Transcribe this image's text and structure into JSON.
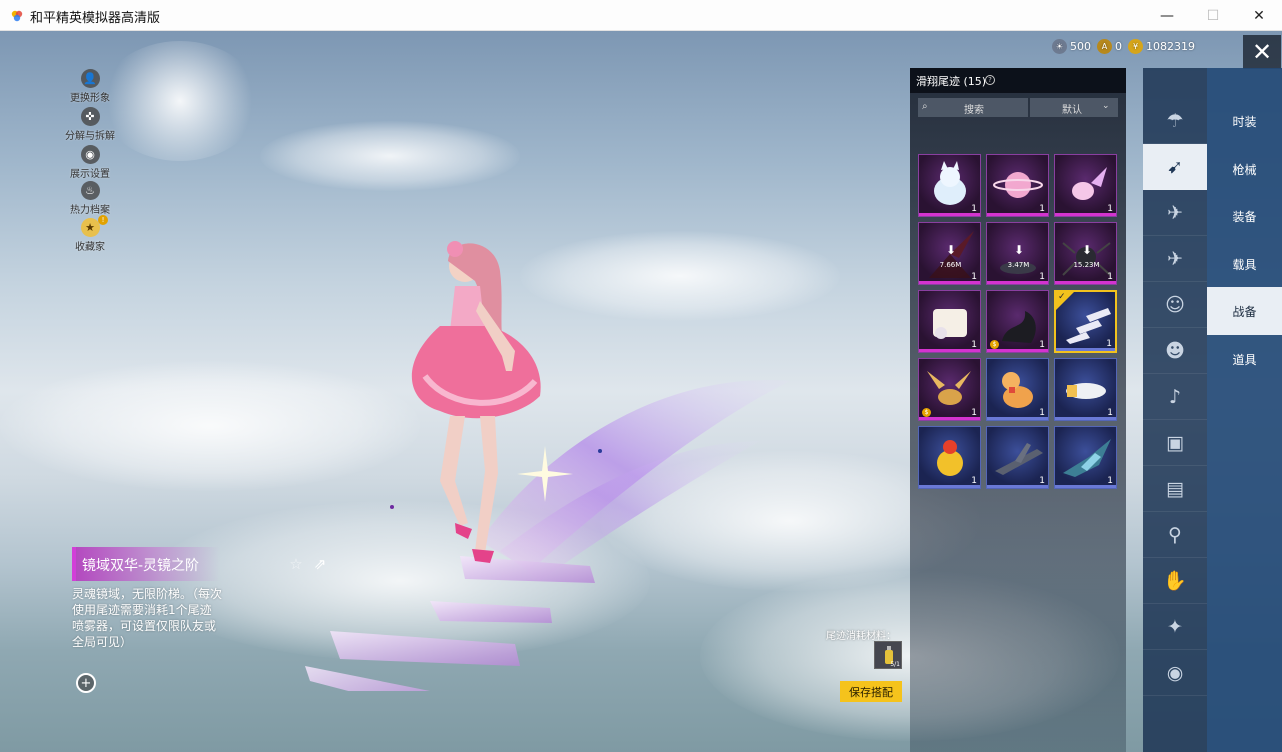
{
  "window": {
    "title": "和平精英模拟器高清版",
    "minimize": "—",
    "maximize": "☐",
    "close": "✕"
  },
  "tools": [
    {
      "label": "更换形象",
      "icon": "person-icon"
    },
    {
      "label": "分解与拆解",
      "icon": "decompose-icon"
    },
    {
      "label": "展示设置",
      "icon": "eye-icon"
    },
    {
      "label": "热力档案",
      "icon": "flame-icon"
    },
    {
      "label": "收藏家",
      "icon": "collector-icon"
    }
  ],
  "item": {
    "name": "镜域双华-灵镜之阶",
    "description": "灵魂镜域，无限阶梯。（每次使用尾迹需要消耗1个尾迹喷雾器，可设置仅限队友或全局可见）",
    "star": "☆",
    "share": "⇗",
    "zoom": "+"
  },
  "currency": [
    {
      "value": "500",
      "icon": "sun-coin-icon",
      "color": "#6d7a90"
    },
    {
      "value": "0",
      "icon": "ag-coin-icon",
      "color": "#b7891d"
    },
    {
      "value": "1082319",
      "icon": "gold-coin-icon",
      "color": "#d6a51a"
    }
  ],
  "close_label": "✕",
  "panel": {
    "title": "滑翔尾迹 (15)",
    "help": "?",
    "search_placeholder": "搜索",
    "search_icon": "⌕",
    "sort_label": "默认",
    "sort_chevron": "⌄"
  },
  "grid_items": [
    {
      "name": "cat-trail",
      "tier": "purple",
      "count": "1"
    },
    {
      "name": "planet-trail",
      "tier": "purple",
      "count": "1"
    },
    {
      "name": "crystal-trail",
      "tier": "purple",
      "count": "1"
    },
    {
      "name": "dark-blade-trail",
      "tier": "purple",
      "count": "1",
      "download": "7.66M"
    },
    {
      "name": "shark-trail",
      "tier": "purple",
      "count": "1",
      "download": "3.47M"
    },
    {
      "name": "spider-trail",
      "tier": "purple",
      "count": "1",
      "download": "15.23M"
    },
    {
      "name": "bunny-box-trail",
      "tier": "purple",
      "count": "1"
    },
    {
      "name": "dragon-trail",
      "tier": "purple",
      "count": "1",
      "locked": true
    },
    {
      "name": "mirror-steps-trail",
      "tier": "blue",
      "count": "1",
      "selected": true
    },
    {
      "name": "pegasus-trail",
      "tier": "purple",
      "count": "1",
      "locked": true
    },
    {
      "name": "toy-horse-trail",
      "tier": "blue",
      "count": "1"
    },
    {
      "name": "jet-trail",
      "tier": "blue",
      "count": "1"
    },
    {
      "name": "chick-trail",
      "tier": "blue",
      "count": "1"
    },
    {
      "name": "plane-trail",
      "tier": "blue",
      "count": "1"
    },
    {
      "name": "mecha-trail",
      "tier": "blue",
      "count": "1"
    }
  ],
  "materials": {
    "label": "尾迹消耗材料：",
    "qty": "5/1"
  },
  "save_button": "保存搭配",
  "categories": [
    {
      "icon": "parachute-icon",
      "glyph": "☂"
    },
    {
      "icon": "glider-trail-icon",
      "glyph": "➹",
      "active": true
    },
    {
      "icon": "drone-icon",
      "glyph": "✈"
    },
    {
      "icon": "plane-icon",
      "glyph": "✈"
    },
    {
      "icon": "emote-icon",
      "glyph": "☺"
    },
    {
      "icon": "companion-icon",
      "glyph": "☻"
    },
    {
      "icon": "voice-icon",
      "glyph": "♪"
    },
    {
      "icon": "kit-icon",
      "glyph": "▣"
    },
    {
      "icon": "photo-icon",
      "glyph": "▤"
    },
    {
      "icon": "spray-icon",
      "glyph": "⚲"
    },
    {
      "icon": "gesture-icon",
      "glyph": "✋"
    },
    {
      "icon": "magic-icon",
      "glyph": "✦"
    },
    {
      "icon": "ufo-icon",
      "glyph": "◉"
    }
  ],
  "tabs": [
    {
      "label": "时装"
    },
    {
      "label": "枪械"
    },
    {
      "label": "装备"
    },
    {
      "label": "载具"
    },
    {
      "label": "战备",
      "active": true
    },
    {
      "label": "道具"
    }
  ]
}
